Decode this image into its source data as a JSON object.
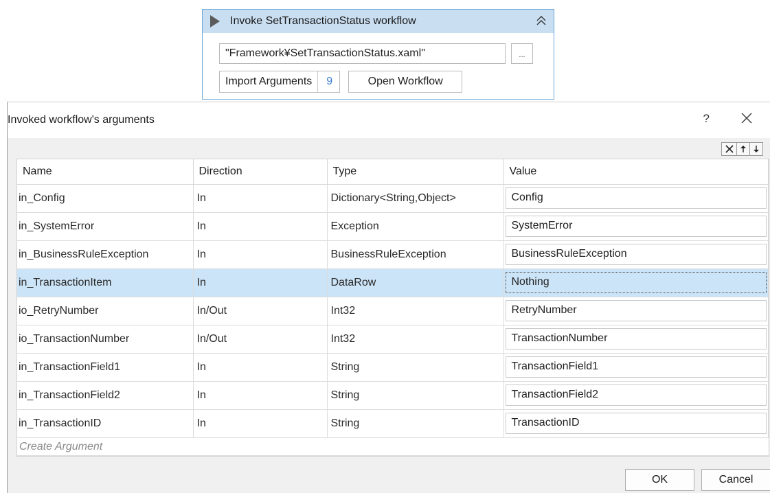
{
  "activity": {
    "title": "Invoke SetTransactionStatus workflow",
    "icons": {
      "play": "play-icon",
      "collapse": "double-chevron-up-icon"
    },
    "workflow_path": "\"Framework¥SetTransactionStatus.xaml\"",
    "browse_label": "...",
    "import_label": "Import Arguments",
    "import_count": "9",
    "open_label": "Open Workflow"
  },
  "dialog": {
    "title": "Invoked workflow's arguments",
    "help_label": "?",
    "toolbar_icons": [
      "delete-icon",
      "arrow-up-icon",
      "arrow-down-icon"
    ],
    "columns": [
      "Name",
      "Direction",
      "Type",
      "Value"
    ],
    "rows": [
      {
        "name": "in_Config",
        "direction": "In",
        "type": "Dictionary<String,Object>",
        "value": "Config"
      },
      {
        "name": "in_SystemError",
        "direction": "In",
        "type": "Exception",
        "value": "SystemError"
      },
      {
        "name": "in_BusinessRuleException",
        "direction": "In",
        "type": "BusinessRuleException",
        "value": "BusinessRuleException"
      },
      {
        "name": "in_TransactionItem",
        "direction": "In",
        "type": "DataRow",
        "value": "Nothing"
      },
      {
        "name": "io_RetryNumber",
        "direction": "In/Out",
        "type": "Int32",
        "value": "RetryNumber"
      },
      {
        "name": "io_TransactionNumber",
        "direction": "In/Out",
        "type": "Int32",
        "value": "TransactionNumber"
      },
      {
        "name": "in_TransactionField1",
        "direction": "In",
        "type": "String",
        "value": "TransactionField1"
      },
      {
        "name": "in_TransactionField2",
        "direction": "In",
        "type": "String",
        "value": "TransactionField2"
      },
      {
        "name": "in_TransactionID",
        "direction": "In",
        "type": "String",
        "value": "TransactionID"
      }
    ],
    "selected_row_index": 3,
    "create_label": "Create Argument",
    "ok_label": "OK",
    "cancel_label": "Cancel"
  },
  "colors": {
    "header_bg": "#c9def1",
    "selection": "#cce4f7",
    "accent": "#3b7ed0"
  }
}
